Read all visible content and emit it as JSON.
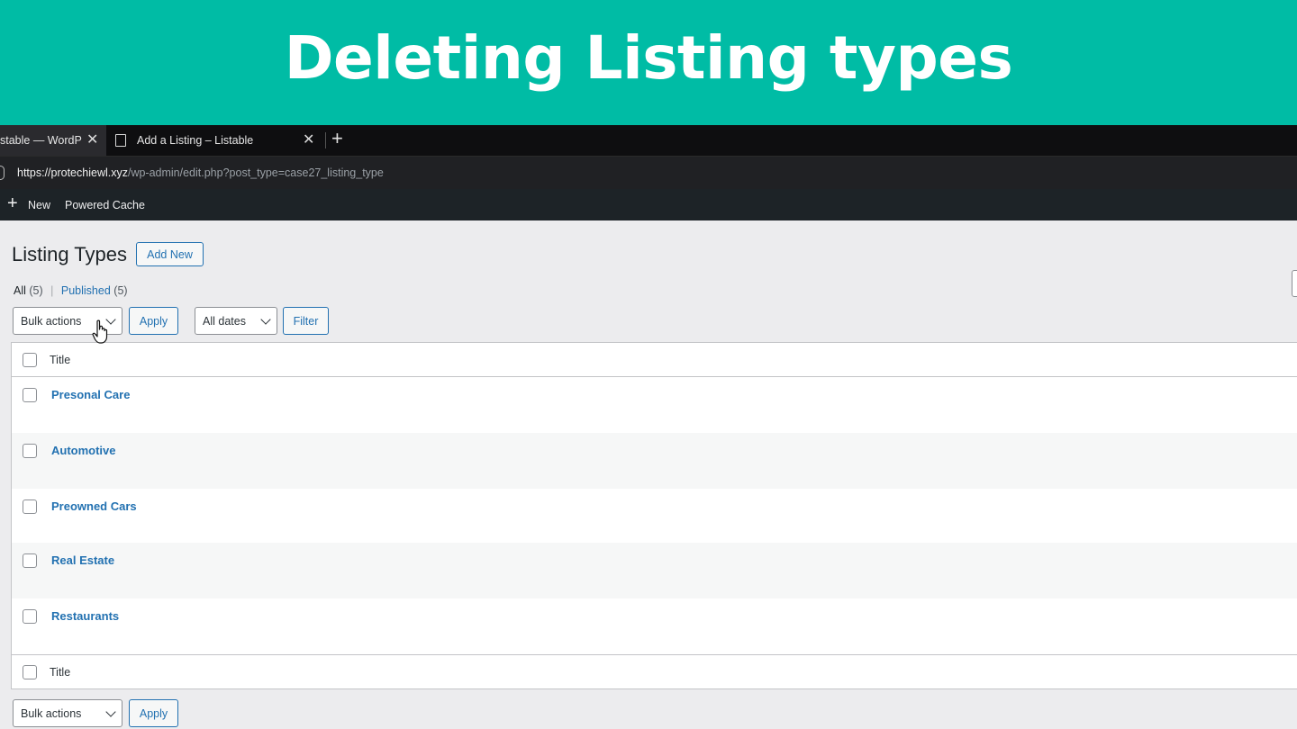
{
  "banner": {
    "title": "Deleting Listing types"
  },
  "browser": {
    "tabs": [
      {
        "title": "stable — WordP",
        "close": "✕"
      },
      {
        "title": "Add a Listing – Listable",
        "close": "✕"
      }
    ],
    "new_tab": "+",
    "url_host": "https://protechiewl.xyz",
    "url_path": "/wp-admin/edit.php?post_type=case27_listing_type"
  },
  "admin_bar": {
    "new_icon": "+",
    "new_label": "New",
    "cache_label": "Powered Cache"
  },
  "page": {
    "title": "Listing Types",
    "add_new": "Add New",
    "views": {
      "all_label": "All",
      "all_count": "(5)",
      "separator": "|",
      "published_label": "Published",
      "published_count": "(5)"
    }
  },
  "filters": {
    "bulk_actions": "Bulk actions",
    "apply": "Apply",
    "dates": "All dates",
    "filter": "Filter"
  },
  "table": {
    "column_title": "Title",
    "rows": [
      {
        "title": "Presonal Care"
      },
      {
        "title": "Automotive"
      },
      {
        "title": "Preowned Cars"
      },
      {
        "title": "Real Estate"
      },
      {
        "title": "Restaurants"
      }
    ]
  },
  "bottom_filters": {
    "bulk_actions": "Bulk actions",
    "apply": "Apply"
  },
  "colors": {
    "banner": "#00bca5",
    "wp_blue": "#2271b1",
    "admin_bar": "#1d2327"
  }
}
